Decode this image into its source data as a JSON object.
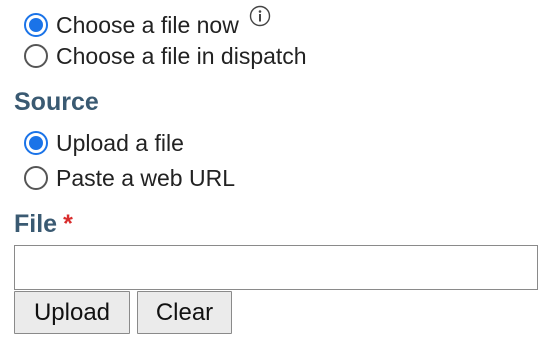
{
  "mode": {
    "options": [
      {
        "label": "Choose a file now",
        "checked": true
      },
      {
        "label": "Choose a file in dispatch",
        "checked": false
      }
    ],
    "info_icon": "info-icon"
  },
  "source": {
    "heading": "Source",
    "options": [
      {
        "label": "Upload a file",
        "checked": true
      },
      {
        "label": "Paste a web URL",
        "checked": false
      }
    ]
  },
  "file": {
    "label": "File",
    "required_marker": "*",
    "value": "",
    "placeholder": ""
  },
  "buttons": {
    "upload_label": "Upload",
    "clear_label": "Clear"
  },
  "colors": {
    "accent": "#1a73e8",
    "heading": "#3a5a72",
    "required": "#d92d2d"
  }
}
